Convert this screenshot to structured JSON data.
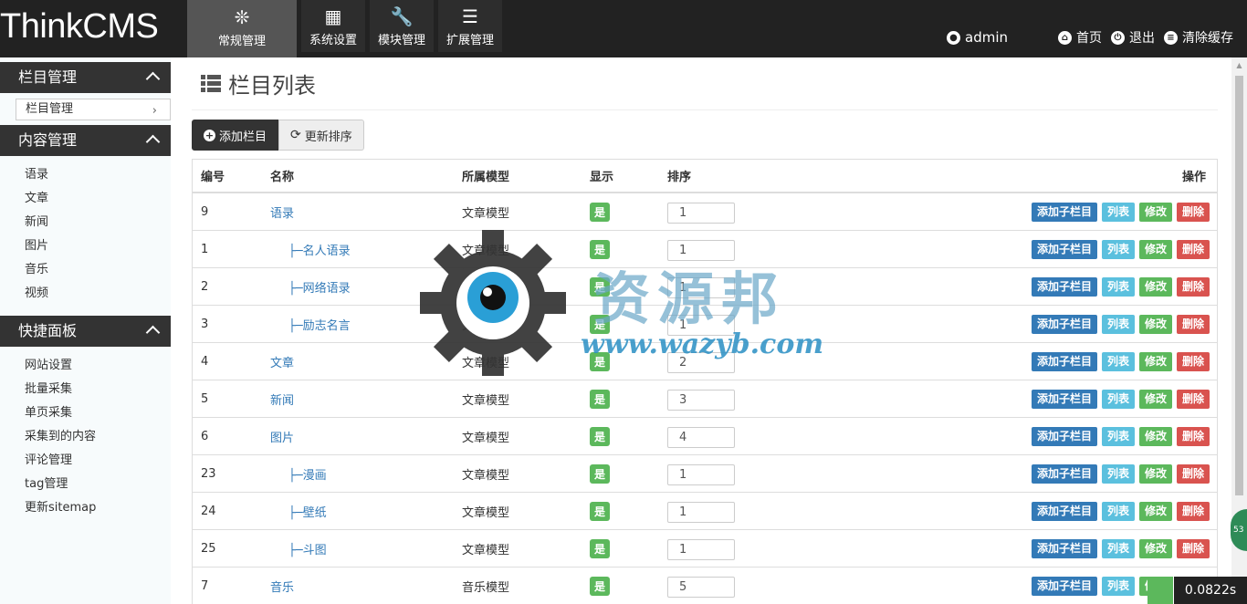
{
  "header": {
    "logo": "ThinkCMS",
    "nav": [
      {
        "label": "常规管理",
        "icon": "❊",
        "active": true
      },
      {
        "label": "系统设置",
        "icon": "▦",
        "active": false
      },
      {
        "label": "模块管理",
        "icon": "🔧",
        "active": false
      },
      {
        "label": "扩展管理",
        "icon": "☰",
        "active": false
      }
    ],
    "user": "admin",
    "links": [
      "首页",
      "退出",
      "清除缓存"
    ]
  },
  "sidebar": {
    "sections": [
      {
        "title": "栏目管理",
        "items": [
          "栏目管理"
        ],
        "boxed": true
      },
      {
        "title": "内容管理",
        "items": [
          "语录",
          "文章",
          "新闻",
          "图片",
          "音乐",
          "视频"
        ]
      },
      {
        "title": "快捷面板",
        "items": [
          "网站设置",
          "批量采集",
          "单页采集",
          "采集到的内容",
          "评论管理",
          "tag管理",
          "更新sitemap"
        ]
      }
    ]
  },
  "main": {
    "title": "栏目列表",
    "toolbar": {
      "add": "添加栏目",
      "refresh": "更新排序"
    },
    "table": {
      "headers": {
        "id": "编号",
        "name": "名称",
        "model": "所属模型",
        "show": "显示",
        "sort": "排序",
        "ops": "操作"
      },
      "rows": [
        {
          "id": "9",
          "name": "语录",
          "model": "文章模型",
          "show": "是",
          "sort": "1"
        },
        {
          "id": "1",
          "name": "├─名人语录",
          "model": "文章模型",
          "show": "是",
          "sort": "1",
          "child": true
        },
        {
          "id": "2",
          "name": "├─网络语录",
          "model": "文章模型",
          "show": "是",
          "sort": "1",
          "child": true
        },
        {
          "id": "3",
          "name": "├─励志名言",
          "model": "文章模型",
          "show": "是",
          "sort": "1",
          "child": true
        },
        {
          "id": "4",
          "name": "文章",
          "model": "文章模型",
          "show": "是",
          "sort": "2"
        },
        {
          "id": "5",
          "name": "新闻",
          "model": "文章模型",
          "show": "是",
          "sort": "3"
        },
        {
          "id": "6",
          "name": "图片",
          "model": "文章模型",
          "show": "是",
          "sort": "4"
        },
        {
          "id": "23",
          "name": "├─漫画",
          "model": "文章模型",
          "show": "是",
          "sort": "1",
          "child": true
        },
        {
          "id": "24",
          "name": "├─壁纸",
          "model": "文章模型",
          "show": "是",
          "sort": "1",
          "child": true
        },
        {
          "id": "25",
          "name": "├─斗图",
          "model": "文章模型",
          "show": "是",
          "sort": "1",
          "child": true
        },
        {
          "id": "7",
          "name": "音乐",
          "model": "音乐模型",
          "show": "是",
          "sort": "5"
        }
      ],
      "actions": [
        "添加子栏目",
        "列表",
        "修改",
        "删除"
      ]
    }
  },
  "watermark": {
    "text": "资源邦",
    "url": "www.wazyb.com"
  },
  "timer": "0.0822s",
  "badge": "53"
}
